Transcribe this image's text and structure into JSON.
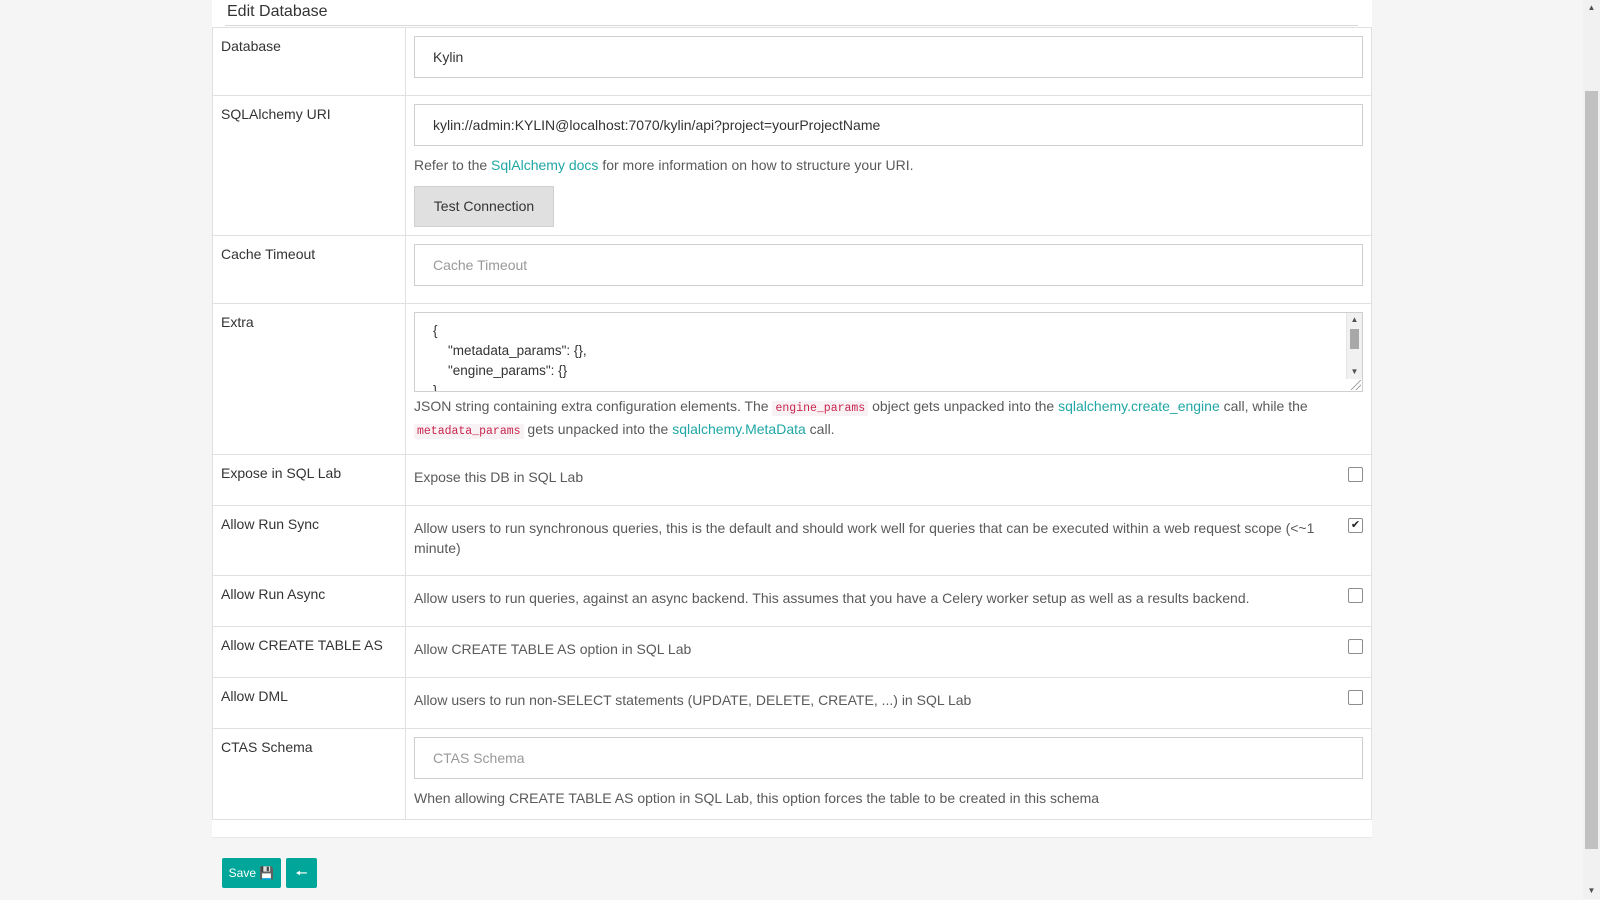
{
  "header": {
    "title": "Edit Database"
  },
  "fields": {
    "database": {
      "label": "Database",
      "value": "Kylin"
    },
    "uri": {
      "label": "SQLAlchemy URI",
      "value": "kylin://admin:KYLIN@localhost:7070/kylin/api?project=yourProjectName",
      "help_prefix": "Refer to the ",
      "help_link": "SqlAlchemy docs",
      "help_suffix": " for more information on how to structure your URI.",
      "test_button": "Test Connection"
    },
    "cache_timeout": {
      "label": "Cache Timeout",
      "placeholder": "Cache Timeout"
    },
    "extra": {
      "label": "Extra",
      "value": "{\n    \"metadata_params\": {},\n    \"engine_params\": {}\n}",
      "help_1": "JSON string containing extra configuration elements. The ",
      "code_1": "engine_params",
      "help_2": " object gets unpacked into the ",
      "link_1": "sqlalchemy.create_engine",
      "help_3": " call, while the ",
      "code_2": "metadata_params",
      "help_4": " gets unpacked into the ",
      "link_2": "sqlalchemy.MetaData",
      "help_5": " call."
    },
    "expose_sql_lab": {
      "label": "Expose in SQL Lab",
      "description": "Expose this DB in SQL Lab",
      "checked": false
    },
    "allow_run_sync": {
      "label": "Allow Run Sync",
      "description": "Allow users to run synchronous queries, this is the default and should work well for queries that can be executed within a web request scope (<~1 minute)",
      "checked": true
    },
    "allow_run_async": {
      "label": "Allow Run Async",
      "description": "Allow users to run queries, against an async backend. This assumes that you have a Celery worker setup as well as a results backend.",
      "checked": false
    },
    "allow_ctas": {
      "label": "Allow CREATE TABLE AS",
      "description": "Allow CREATE TABLE AS option in SQL Lab",
      "checked": false
    },
    "allow_dml": {
      "label": "Allow DML",
      "description": "Allow users to run non-SELECT statements (UPDATE, DELETE, CREATE, ...) in SQL Lab",
      "checked": false
    },
    "ctas_schema": {
      "label": "CTAS Schema",
      "placeholder": "CTAS Schema",
      "help": "When allowing CREATE TABLE AS option in SQL Lab, this option forces the table to be created in this schema"
    }
  },
  "footer": {
    "save_label": "Save"
  },
  "colors": {
    "accent": "#00a699",
    "link": "#20a7a5"
  }
}
